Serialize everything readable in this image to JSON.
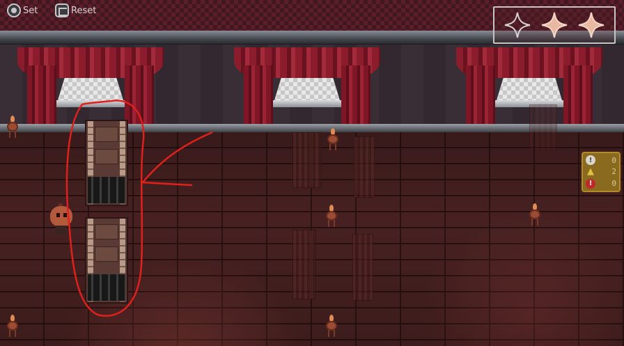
{
  "toolbar": {
    "set_label": "Set",
    "reset_label": "Reset"
  },
  "stars": {
    "earned": 2,
    "total": 3
  },
  "counters": {
    "info": "0",
    "warning": "2",
    "error": "0"
  },
  "colors": {
    "annotation": "#e0201c",
    "star_filled": "#e8b8a0",
    "counter_bg": "#8a6a1e"
  }
}
